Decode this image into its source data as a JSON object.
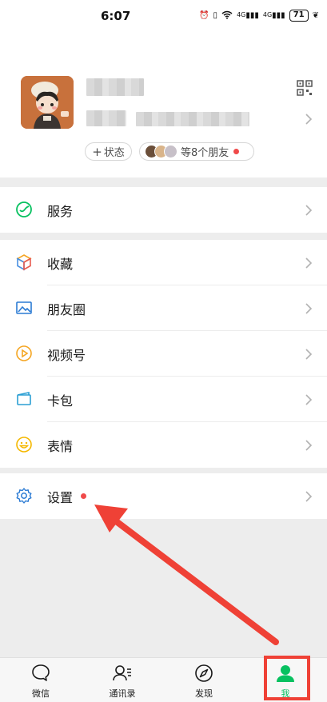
{
  "status_bar": {
    "time": "6:07",
    "network": "4G",
    "battery": "71"
  },
  "profile": {
    "status_button": "状态",
    "friends_status": "等8个朋友"
  },
  "menu": {
    "services": "服务",
    "favorites": "收藏",
    "moments": "朋友圈",
    "channels": "视频号",
    "cards": "卡包",
    "stickers": "表情",
    "settings": "设置"
  },
  "tabbar": {
    "chats": "微信",
    "contacts": "通讯录",
    "discover": "发现",
    "me": "我"
  },
  "colors": {
    "accent": "#07c160",
    "badge": "#f04a4a",
    "annotation": "#ef4136"
  }
}
